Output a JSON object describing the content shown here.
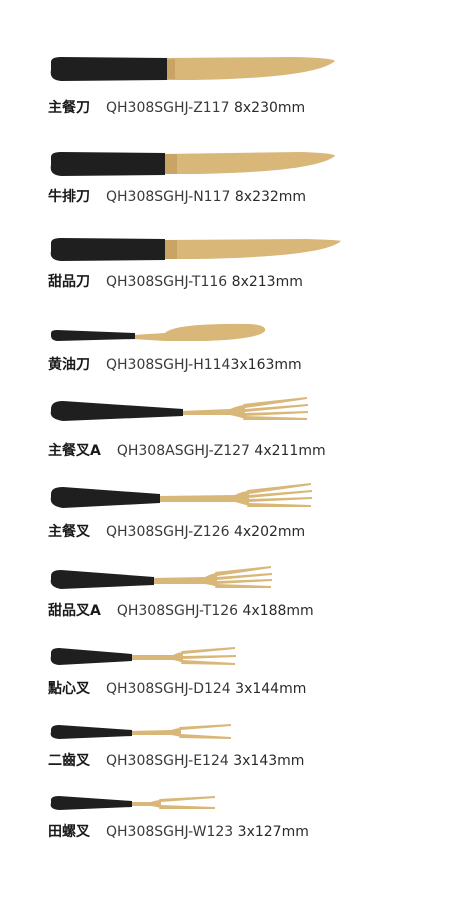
{
  "colors": {
    "handle": "#1f1f1f",
    "metal": "#d9b779",
    "metal_dark": "#b8955a"
  },
  "items": [
    {
      "name": "主餐刀",
      "code": "QH308SGHJ-Z117",
      "size": "8x230mm",
      "type": "knife"
    },
    {
      "name": "牛排刀",
      "code": "QH308SGHJ-N117",
      "size": "8x232mm",
      "type": "knife"
    },
    {
      "name": "甜品刀",
      "code": "QH308SGHJ-T116",
      "size": "8x213mm",
      "type": "knife"
    },
    {
      "name": "黄油刀",
      "code": "QH308SGHJ-H114",
      "size": "3x163mm",
      "type": "butter-knife"
    },
    {
      "name": "主餐叉A",
      "code": "QH308ASGHJ-Z127",
      "size": "4x211mm",
      "type": "fork-4"
    },
    {
      "name": "主餐叉",
      "code": "QH308SGHJ-Z126",
      "size": "4x202mm",
      "type": "fork-4"
    },
    {
      "name": "甜品叉A",
      "code": "QH308SGHJ-T126",
      "size": "4x188mm",
      "type": "fork-4"
    },
    {
      "name": "點心叉",
      "code": "QH308SGHJ-D124",
      "size": "3x144mm",
      "type": "fork-3"
    },
    {
      "name": "二齒叉",
      "code": "QH308SGHJ-E124",
      "size": "3x143mm",
      "type": "fork-2"
    },
    {
      "name": "田螺叉",
      "code": "QH308SGHJ-W123",
      "size": "3x127mm",
      "type": "fork-2"
    }
  ]
}
